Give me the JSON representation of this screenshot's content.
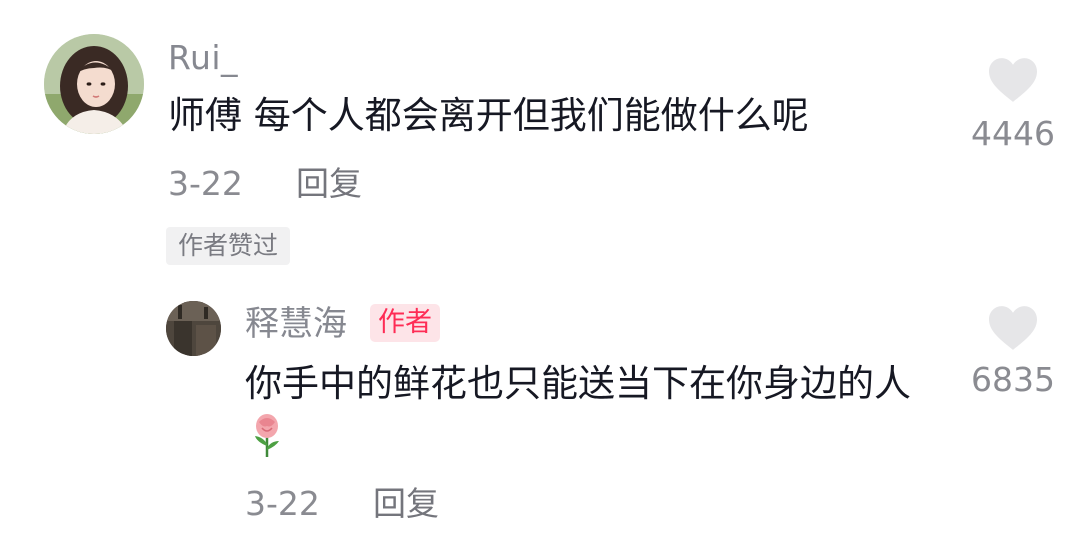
{
  "comment": {
    "username": "Rui_",
    "text": "师傅 每个人都会离开但我们能做什么呢",
    "date": "3-22",
    "reply_label": "回复",
    "liked_badge": "作者赞过",
    "like_count": "4446"
  },
  "reply": {
    "author": "释慧海",
    "author_tag": "作者",
    "text": "你手中的鲜花也只能送当下在你身边的人",
    "emoji": "rose-emoji",
    "date": "3-22",
    "reply_label": "回复",
    "like_count": "6835"
  },
  "icons": {
    "like": "heart-icon"
  },
  "colors": {
    "author_tag_text": "#fe2c55",
    "author_tag_bg": "#fde4e8",
    "heart": "#e6e6e8"
  }
}
